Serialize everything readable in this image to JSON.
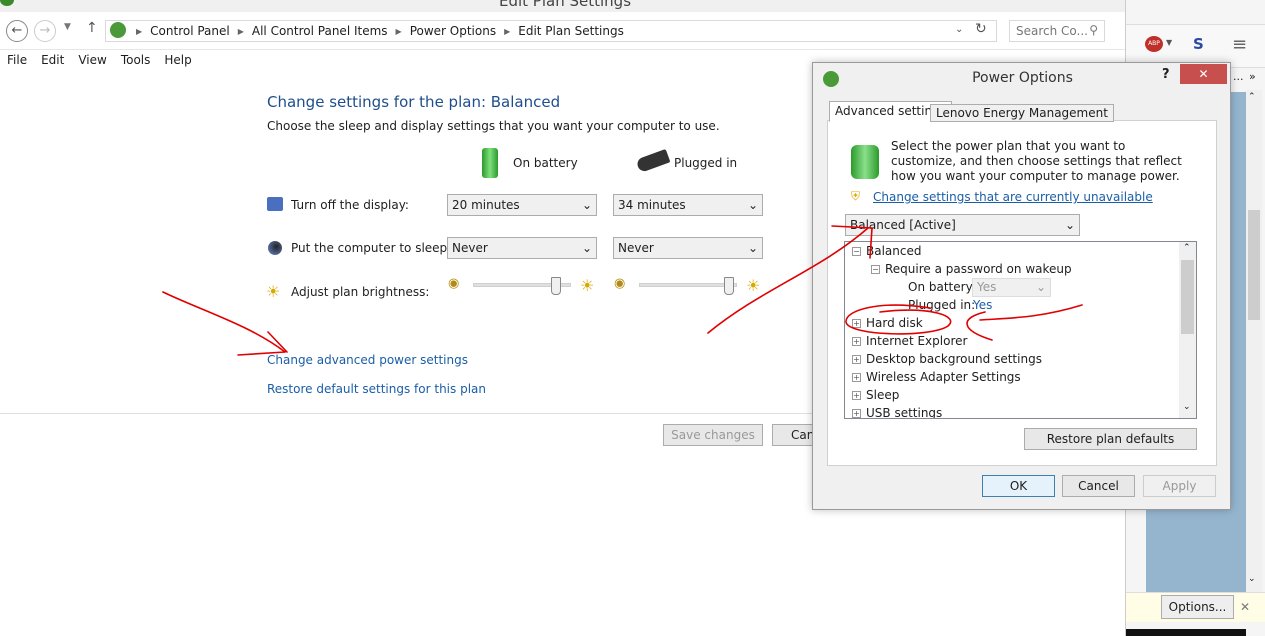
{
  "window": {
    "title": "Edit Plan Settings"
  },
  "nav": {
    "breadcrumbs": [
      "Control Panel",
      "All Control Panel Items",
      "Power Options",
      "Edit Plan Settings"
    ],
    "search_placeholder": "Search Co..."
  },
  "menu": [
    "File",
    "Edit",
    "View",
    "Tools",
    "Help"
  ],
  "plan": {
    "heading": "Change settings for the plan: Balanced",
    "subheading": "Choose the sleep and display settings that you want your computer to use.",
    "col_battery": "On battery",
    "col_plugged": "Plugged in",
    "rows": [
      {
        "label": "Turn off the display:",
        "battery": "20 minutes",
        "plugged": "34 minutes"
      },
      {
        "label": "Put the computer to sleep:",
        "battery": "Never",
        "plugged": "Never"
      }
    ],
    "brightness_label": "Adjust plan brightness:",
    "brightness_battery_pct": 85,
    "brightness_plugged_pct": 92,
    "advanced_link": "Change advanced power settings",
    "restore_link": "Restore default settings for this plan",
    "save_button": "Save changes",
    "cancel_button": "Cancel"
  },
  "dialog": {
    "title": "Power Options",
    "help": "?",
    "close": "✕",
    "tabs": [
      "Advanced settings",
      "Lenovo Energy Management"
    ],
    "description": "Select the power plan that you want to customize, and then choose settings that reflect how you want your computer to manage power.",
    "unavailable_link": "Change settings that are currently unavailable",
    "plan_select": "Balanced [Active]",
    "tree": {
      "root": "Balanced",
      "child": "Require a password on wakeup",
      "on_battery_label": "On battery:",
      "on_battery_value": "Yes",
      "plugged_label": "Plugged in:",
      "plugged_value": "Yes",
      "items": [
        "Hard disk",
        "Internet Explorer",
        "Desktop background settings",
        "Wireless Adapter Settings",
        "Sleep",
        "USB settings"
      ]
    },
    "restore_button": "Restore plan defaults",
    "ok": "OK",
    "cancel": "Cancel",
    "apply": "Apply"
  },
  "browser": {
    "abp": "ABP",
    "overflow": "...",
    "chevrons": "»",
    "options_button": "Options...",
    "close": "✕"
  },
  "colors": {
    "link": "#1a5ea8",
    "close_red": "#c7504f",
    "annotation": "#e00000",
    "panel_blue": "#95b5cf",
    "notify": "#fffde6"
  }
}
